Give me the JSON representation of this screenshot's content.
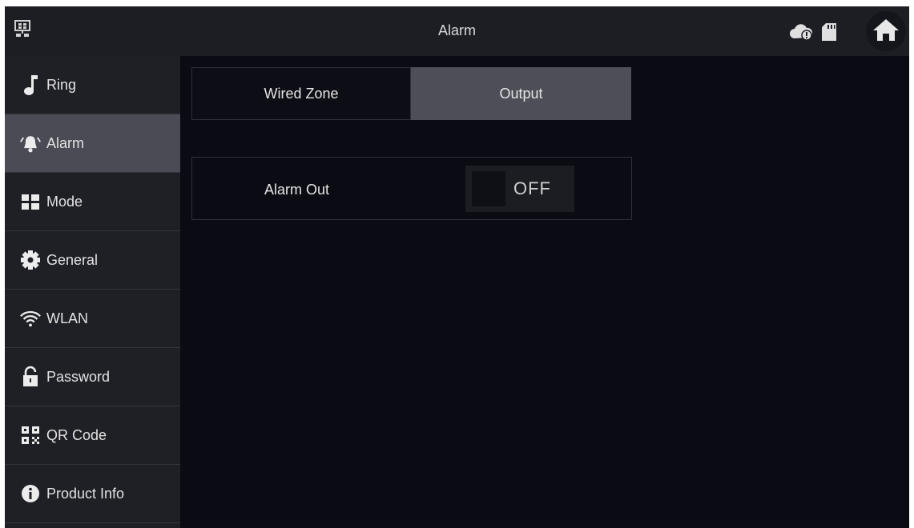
{
  "header": {
    "title": "Alarm",
    "icons": [
      "network-icon",
      "cloud-alert-icon",
      "sd-card-icon",
      "home-icon"
    ]
  },
  "sidebar": {
    "items": [
      {
        "label": "Ring",
        "icon": "music-note-icon",
        "active": false
      },
      {
        "label": "Alarm",
        "icon": "alarm-bell-icon",
        "active": true
      },
      {
        "label": "Mode",
        "icon": "mode-grid-icon",
        "active": false
      },
      {
        "label": "General",
        "icon": "gear-icon",
        "active": false
      },
      {
        "label": "WLAN",
        "icon": "wifi-icon",
        "active": false
      },
      {
        "label": "Password",
        "icon": "lock-icon",
        "active": false
      },
      {
        "label": "QR Code",
        "icon": "qr-code-icon",
        "active": false
      },
      {
        "label": "Product Info",
        "icon": "info-icon",
        "active": false
      }
    ]
  },
  "tabs": [
    {
      "label": "Wired Zone",
      "active": false
    },
    {
      "label": "Output",
      "active": true
    }
  ],
  "settings": {
    "alarm_out": {
      "label": "Alarm Out",
      "state": "OFF"
    }
  },
  "colors": {
    "background": "#0b0b13",
    "sidebar": "#1f2026",
    "active_item": "#4a4b54",
    "text": "#e2e2e2"
  }
}
